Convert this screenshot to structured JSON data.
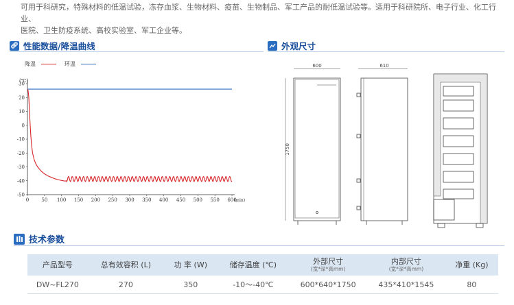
{
  "intro": {
    "line1": "可用于科研究，特殊材料的低温试验，冻存血浆、生物材料、疫苗、生物制品、军工产品的耐低温试验等。适用于科研院所、电子行业、化工行业、",
    "line2": "医院、卫生防疫系统、高校实验室、军工企业等。"
  },
  "sections": {
    "performance_title": "性能数据/降温曲线",
    "dimensions_title": "外观尺寸",
    "specs_title": "技术参数"
  },
  "colors": {
    "accent": "#1a4f9c",
    "cooling_line": "#d8262b",
    "ambient_line": "#2a6cc0",
    "table_header_bg": "#dbe6f3"
  },
  "chart_data": {
    "type": "line",
    "title": "",
    "ylabel": "(℃)",
    "xlabel_unit": "(min)",
    "ylim": [
      -50,
      30
    ],
    "xlim": [
      0,
      600
    ],
    "yticks": [
      30,
      20,
      10,
      0,
      -10,
      -20,
      -30,
      -40,
      -50
    ],
    "xticks": [
      "0",
      "50",
      "100",
      "150",
      "200",
      "250",
      "300",
      "350",
      "400",
      "450",
      "500",
      "550",
      "600"
    ],
    "grid": false,
    "legend_position": "top-left",
    "series": [
      {
        "name": "降温",
        "color": "#d8262b",
        "x": [
          0,
          2,
          4,
          6,
          8,
          10,
          12,
          15,
          20,
          25,
          30,
          40,
          50,
          60,
          70,
          80,
          90,
          100,
          110,
          115
        ],
        "y": [
          26,
          25,
          20,
          10,
          0,
          -8,
          -14,
          -20,
          -25,
          -28,
          -30,
          -33,
          -35,
          -36.5,
          -37.5,
          -38.5,
          -39.2,
          -39.8,
          -40.2,
          -40
        ],
        "oscillation": {
          "from_x": 115,
          "to_x": 600,
          "center": -38.7,
          "amplitude": 1.8,
          "period": 11
        }
      },
      {
        "name": "环温",
        "color": "#2a6cc0",
        "x": [
          0,
          600
        ],
        "y": [
          26,
          26
        ]
      }
    ]
  },
  "dimensions": {
    "front_width": "600",
    "side_depth": "610",
    "height": "1750"
  },
  "specs_table": {
    "headers": [
      {
        "main": "产品型号",
        "sub": ""
      },
      {
        "main": "总有效容积 (L)",
        "sub": ""
      },
      {
        "main": "功 率 (W)",
        "sub": ""
      },
      {
        "main": "储存温度 (℃)",
        "sub": ""
      },
      {
        "main": "外部尺寸",
        "sub": "(宽*深*高mm)"
      },
      {
        "main": "内部尺寸",
        "sub": "(宽*深*高mm)"
      },
      {
        "main": "净重 (Kg)",
        "sub": ""
      }
    ],
    "rows": [
      [
        "DW~FL270",
        "270",
        "350",
        "-10～-40℃",
        "600*640*1750",
        "435*410*1545",
        "80"
      ]
    ]
  }
}
